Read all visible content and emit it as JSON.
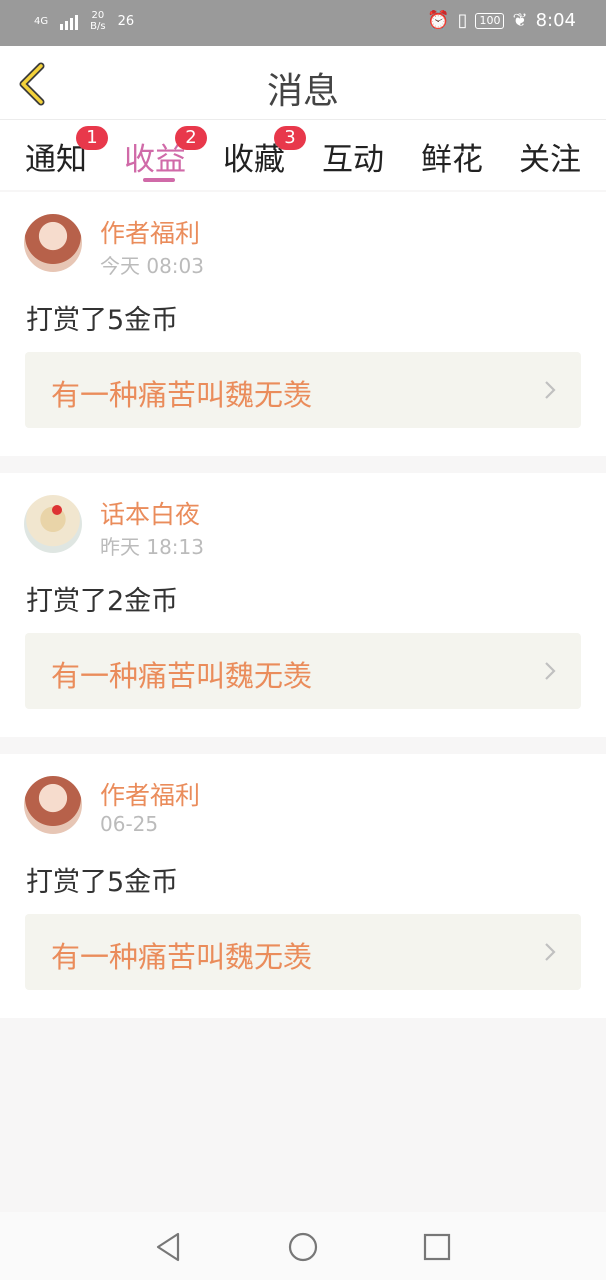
{
  "status_bar": {
    "network": "4G",
    "speed_value": "20",
    "speed_unit": "B/s",
    "temperature": "26",
    "battery": "100",
    "time": "8:04"
  },
  "header": {
    "title": "消息"
  },
  "tabs": [
    {
      "label": "通知",
      "badge": "1"
    },
    {
      "label": "收益",
      "badge": "2"
    },
    {
      "label": "收藏",
      "badge": "3"
    },
    {
      "label": "互动"
    },
    {
      "label": "鲜花"
    },
    {
      "label": "关注"
    }
  ],
  "messages": [
    {
      "name": "作者福利",
      "time": "今天 08:03",
      "text": "打赏了5金币",
      "link": "有一种痛苦叫魏无羡"
    },
    {
      "name": "话本白夜",
      "time": "昨天 18:13",
      "text": "打赏了2金币",
      "link": "有一种痛苦叫魏无羡"
    },
    {
      "name": "作者福利",
      "time": "06-25",
      "text": "打赏了5金币",
      "link": "有一种痛苦叫魏无羡"
    }
  ]
}
